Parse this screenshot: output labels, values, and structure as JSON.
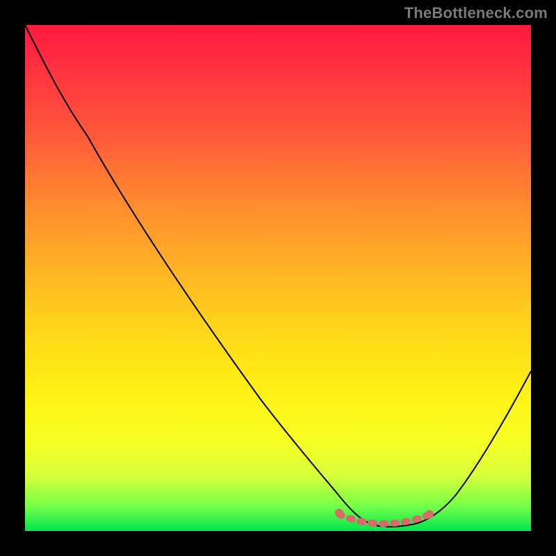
{
  "watermark": "TheBottleneck.com",
  "colors": {
    "background": "#000000",
    "gradient_top": "#ff1a3f",
    "gradient_bottom": "#00e54f",
    "curve": "#000000",
    "trough": "#d86a6a"
  },
  "chart_data": {
    "type": "line",
    "title": "",
    "xlabel": "",
    "ylabel": "",
    "xlim": [
      0,
      100
    ],
    "ylim": [
      0,
      100
    ],
    "grid": false,
    "legend": false,
    "annotations": [
      "TheBottleneck.com"
    ],
    "series": [
      {
        "name": "bottleneck-curve",
        "x": [
          0,
          5,
          12,
          24,
          40,
          52,
          60,
          64,
          68,
          72,
          76,
          80,
          84,
          90,
          96,
          100
        ],
        "y": [
          100,
          92,
          84,
          70,
          46,
          29,
          16,
          8,
          3,
          1,
          1,
          2,
          5,
          15,
          30,
          42
        ],
        "color": "#000000"
      },
      {
        "name": "optimal-range",
        "x": [
          62,
          80
        ],
        "y": [
          2,
          2
        ],
        "color": "#d86a6a",
        "style": "dotted-thick"
      }
    ]
  }
}
